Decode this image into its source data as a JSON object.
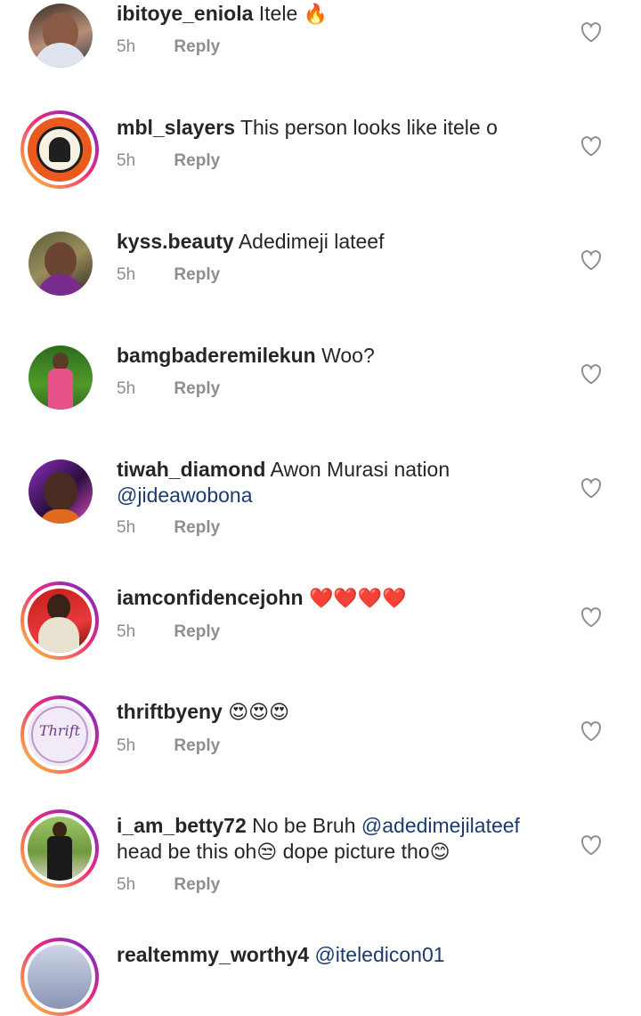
{
  "comments": [
    {
      "user": "ibitoye_eniola",
      "text": "Itele",
      "emoji": "🔥",
      "time": "5h",
      "reply": "Reply"
    },
    {
      "user": "mbl_slayers",
      "text": "This person looks like itele o",
      "time": "5h",
      "reply": "Reply"
    },
    {
      "user": "kyss.beauty",
      "text": "Adedimeji lateef",
      "time": "5h",
      "reply": "Reply"
    },
    {
      "user": "bamgbaderemilekun",
      "text": "Woo?",
      "time": "5h",
      "reply": "Reply"
    },
    {
      "user": "tiwah_diamond",
      "text": "Awon Murasi nation",
      "mention": "@jideawobona",
      "time": "5h",
      "reply": "Reply"
    },
    {
      "user": "iamconfidencejohn",
      "emoji": "❤️❤️❤️❤️",
      "time": "5h",
      "reply": "Reply"
    },
    {
      "user": "thriftbyeny",
      "emoji": "😍😍😍",
      "time": "5h",
      "reply": "Reply"
    },
    {
      "user": "i_am_betty72",
      "text": "No be Bruh",
      "mention": "@adedimejilateef",
      "text2": "head be this oh",
      "emoji2": "😒",
      "text3": "dope picture tho",
      "emoji3": "😊",
      "time": "5h",
      "reply": "Reply"
    },
    {
      "user": "realtemmy_worthy4",
      "mention": "@iteledicon01"
    }
  ],
  "avatar_logo_text": "Thrift",
  "colors": {
    "mention": "#1c3b6e",
    "meta": "#8e8e8e",
    "story_ring": "#ee2a7b"
  }
}
